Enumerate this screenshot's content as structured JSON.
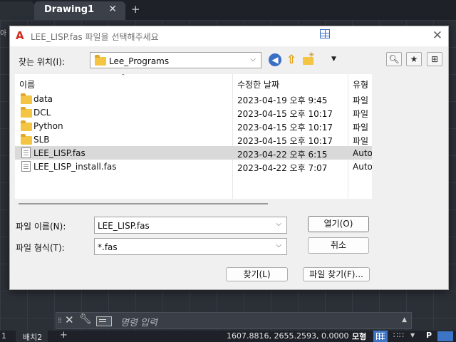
{
  "app": {
    "tabs": {
      "active": "Drawing1",
      "close_glyph": "✕",
      "add_glyph": "+"
    },
    "side_fragment": "아",
    "command_line": {
      "placeholder": "명령 입력"
    },
    "status_bar": {
      "layout_tab_1": "1",
      "layout_tab_2": "배치2",
      "add_glyph": "+",
      "coordinates": "1607.8816, 2655.2593, 0.0000",
      "model_label": "모형",
      "snap_label": "∷∷",
      "p_label": "P"
    }
  },
  "dialog": {
    "title": "LEE_LISP.fas 파일을 선택해주세요",
    "look_in_label": "찾는 위치(I):",
    "look_in_value": "Lee_Programs",
    "columns": {
      "name": "이름",
      "date": "수정한 날짜",
      "type": "유형"
    },
    "files": [
      {
        "name": "data",
        "date": "2023-04-19 오후 9:45",
        "type": "파일",
        "kind": "folder",
        "selected": false
      },
      {
        "name": "DCL",
        "date": "2023-04-15 오후 10:17",
        "type": "파일",
        "kind": "folder",
        "selected": false
      },
      {
        "name": "Python",
        "date": "2023-04-15 오후 10:17",
        "type": "파일",
        "kind": "folder",
        "selected": false
      },
      {
        "name": "SLB",
        "date": "2023-04-15 오후 10:17",
        "type": "파일",
        "kind": "folder",
        "selected": false
      },
      {
        "name": "LEE_LISP.fas",
        "date": "2023-04-22 오후 6:15",
        "type": "Auto",
        "kind": "file",
        "selected": true
      },
      {
        "name": "LEE_LISP_install.fas",
        "date": "2023-04-22 오후 7:07",
        "type": "Auto",
        "kind": "file",
        "selected": false
      }
    ],
    "filename_label": "파일 이름(N):",
    "filename_value": "LEE_LISP.fas",
    "filetype_label": "파일 형식(T):",
    "filetype_value": "*.fas",
    "open_button": "열기(O)",
    "cancel_button": "취소",
    "find_button": "찾기(L)",
    "find_file_button": "파일 찾기(F)...",
    "icons": [
      "back-icon",
      "up-folder-icon",
      "new-folder-icon",
      "views-icon",
      "search-web-icon",
      "favorites-icon",
      "add-to-favorites-icon"
    ]
  }
}
